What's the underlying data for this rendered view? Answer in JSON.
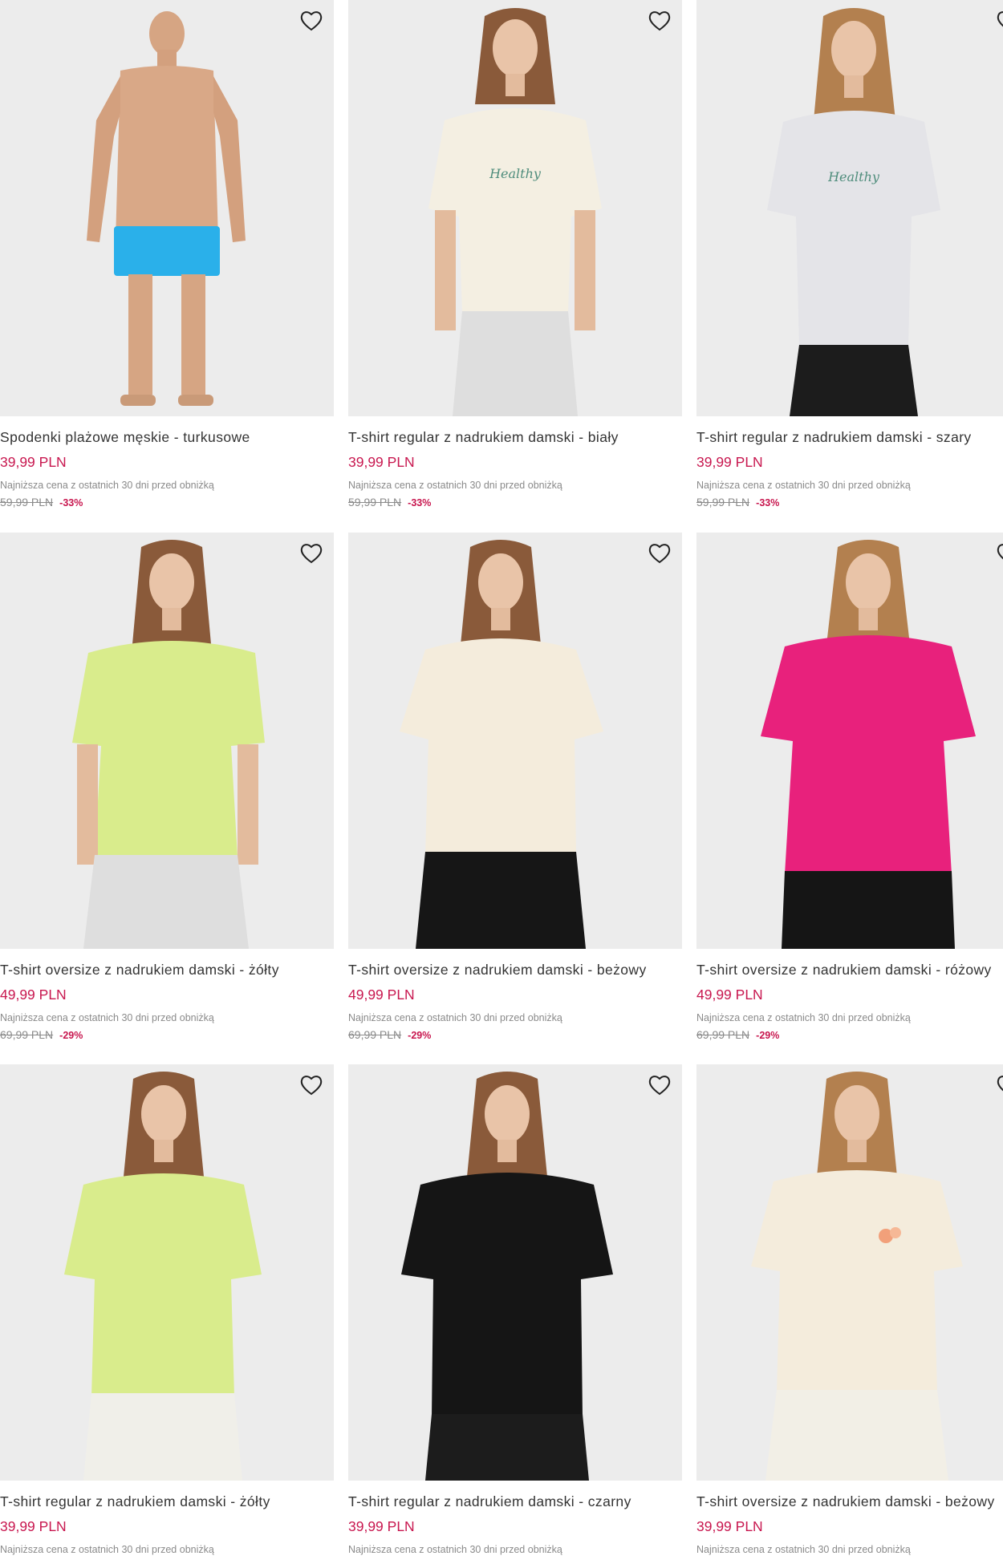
{
  "colors": {
    "price": "#c8174f",
    "discount": "#c8174f",
    "muted": "#8a8a8a",
    "photo_bg": "#ebebeb"
  },
  "products": [
    {
      "name": "Spodenki plażowe męskie - turkusowe",
      "price": "39,99 PLN",
      "lowest_note": "Najniższa cena z ostatnich 30 dni przed obniżką",
      "old_price": "59,99 PLN",
      "discount": "-33%",
      "garment_color": "#2ab0ea",
      "icon": "heart-outline-icon"
    },
    {
      "name": "T-shirt regular z nadrukiem damski - biały",
      "price": "39,99 PLN",
      "lowest_note": "Najniższa cena z ostatnich 30 dni przed obniżką",
      "old_price": "59,99 PLN",
      "discount": "-33%",
      "garment_color": "#f4efe2",
      "icon": "heart-outline-icon"
    },
    {
      "name": "T-shirt regular z nadrukiem damski - szary",
      "price": "39,99 PLN",
      "lowest_note": "Najniższa cena z ostatnich 30 dni przed obniżką",
      "old_price": "59,99 PLN",
      "discount": "-33%",
      "garment_color": "#e4e4e8",
      "icon": "heart-outline-icon"
    },
    {
      "name": "T-shirt oversize z nadrukiem damski - żółty",
      "price": "49,99 PLN",
      "lowest_note": "Najniższa cena z ostatnich 30 dni przed obniżką",
      "old_price": "69,99 PLN",
      "discount": "-29%",
      "garment_color": "#d9ec8c",
      "icon": "heart-outline-icon"
    },
    {
      "name": "T-shirt oversize z nadrukiem damski - beżowy",
      "price": "49,99 PLN",
      "lowest_note": "Najniższa cena z ostatnich 30 dni przed obniżką",
      "old_price": "69,99 PLN",
      "discount": "-29%",
      "garment_color": "#f4ecdc",
      "icon": "heart-outline-icon"
    },
    {
      "name": "T-shirt oversize z nadrukiem damski - różowy",
      "price": "49,99 PLN",
      "lowest_note": "Najniższa cena z ostatnich 30 dni przed obniżką",
      "old_price": "69,99 PLN",
      "discount": "-29%",
      "garment_color": "#e8217c",
      "icon": "heart-outline-icon"
    },
    {
      "name": "T-shirt regular z nadrukiem damski - żółty",
      "price": "39,99 PLN",
      "lowest_note": "Najniższa cena z ostatnich 30 dni przed obniżką",
      "old_price": "",
      "discount": "",
      "garment_color": "#d9ec8c",
      "icon": "heart-outline-icon"
    },
    {
      "name": "T-shirt regular z nadrukiem damski - czarny",
      "price": "39,99 PLN",
      "lowest_note": "Najniższa cena z ostatnich 30 dni przed obniżką",
      "old_price": "",
      "discount": "",
      "garment_color": "#151515",
      "icon": "heart-outline-icon"
    },
    {
      "name": "T-shirt oversize z nadrukiem damski - beżowy",
      "price": "39,99 PLN",
      "lowest_note": "Najniższa cena z ostatnich 30 dni przed obniżką",
      "old_price": "",
      "discount": "",
      "garment_color": "#f4ecdc",
      "icon": "heart-outline-icon"
    }
  ]
}
